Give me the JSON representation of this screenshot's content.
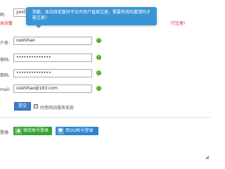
{
  "form": {
    "captcha": {
      "label": "码:",
      "value": "yxxl3v7"
    },
    "error_left": "本站暂",
    "error_right": "行注册!",
    "username": {
      "label": "户名:",
      "value": "ceshihao"
    },
    "password": {
      "label": "密码:",
      "value": "••••••••••••••"
    },
    "confirm": {
      "label": "密码:",
      "value": "••••••••••••••"
    },
    "email": {
      "label": "mail:",
      "value": "ceshihao@163.com"
    },
    "submit_label": "提交",
    "agree_label": "同意网站服务条款"
  },
  "toast": {
    "message": "抱歉，本站目前暂时不允许用户直接注册，需要有效的邀请码才能注册！"
  },
  "social": {
    "section_label": "登录:",
    "wechat_label": "微信账号登录",
    "qq_label": "用QQ帐号登录"
  },
  "colors": {
    "toast_bg": "#3a95d6",
    "ok_green": "#4cae1e",
    "error_red": "#d8232a",
    "submit_blue": "#3d7ec9",
    "wechat_green": "#33a534",
    "qq_blue": "#2a86d0"
  },
  "icons": {
    "ok": "check-circle-icon",
    "checkbox": "checkbox-checked-icon",
    "wechat": "wechat-icon",
    "qq": "qq-icon",
    "resize": "resize-grip-icon"
  }
}
